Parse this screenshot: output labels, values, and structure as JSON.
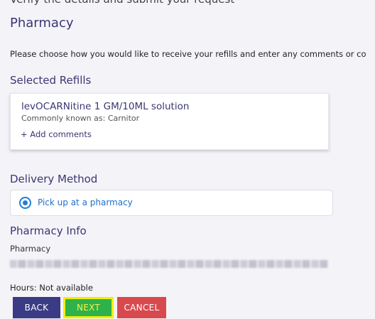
{
  "page": {
    "title": "Pharmacy",
    "top_cut_text": "Verify the details and submit your request",
    "intro": "Please choose how you would like to receive your refills and enter any comments or co"
  },
  "refills": {
    "section_title": "Selected Refills",
    "items": [
      {
        "name": "levOCARNitine 1 GM/10ML solution",
        "known_as": "Commonly known as: Carnitor",
        "add_comments": "+ Add comments"
      }
    ]
  },
  "delivery": {
    "section_title": "Delivery Method",
    "option_label": "Pick up at a pharmacy",
    "selected": true,
    "accent_color": "#1f7fd8"
  },
  "pharmacy_info": {
    "section_title": "Pharmacy Info",
    "field_label": "Pharmacy",
    "hours": "Hours: Not available"
  },
  "buttons": {
    "back": "BACK",
    "next": "NEXT",
    "cancel": "CANCEL",
    "back_color": "#3a3a85",
    "next_color": "#2fb24a",
    "cancel_color": "#d8494e"
  }
}
